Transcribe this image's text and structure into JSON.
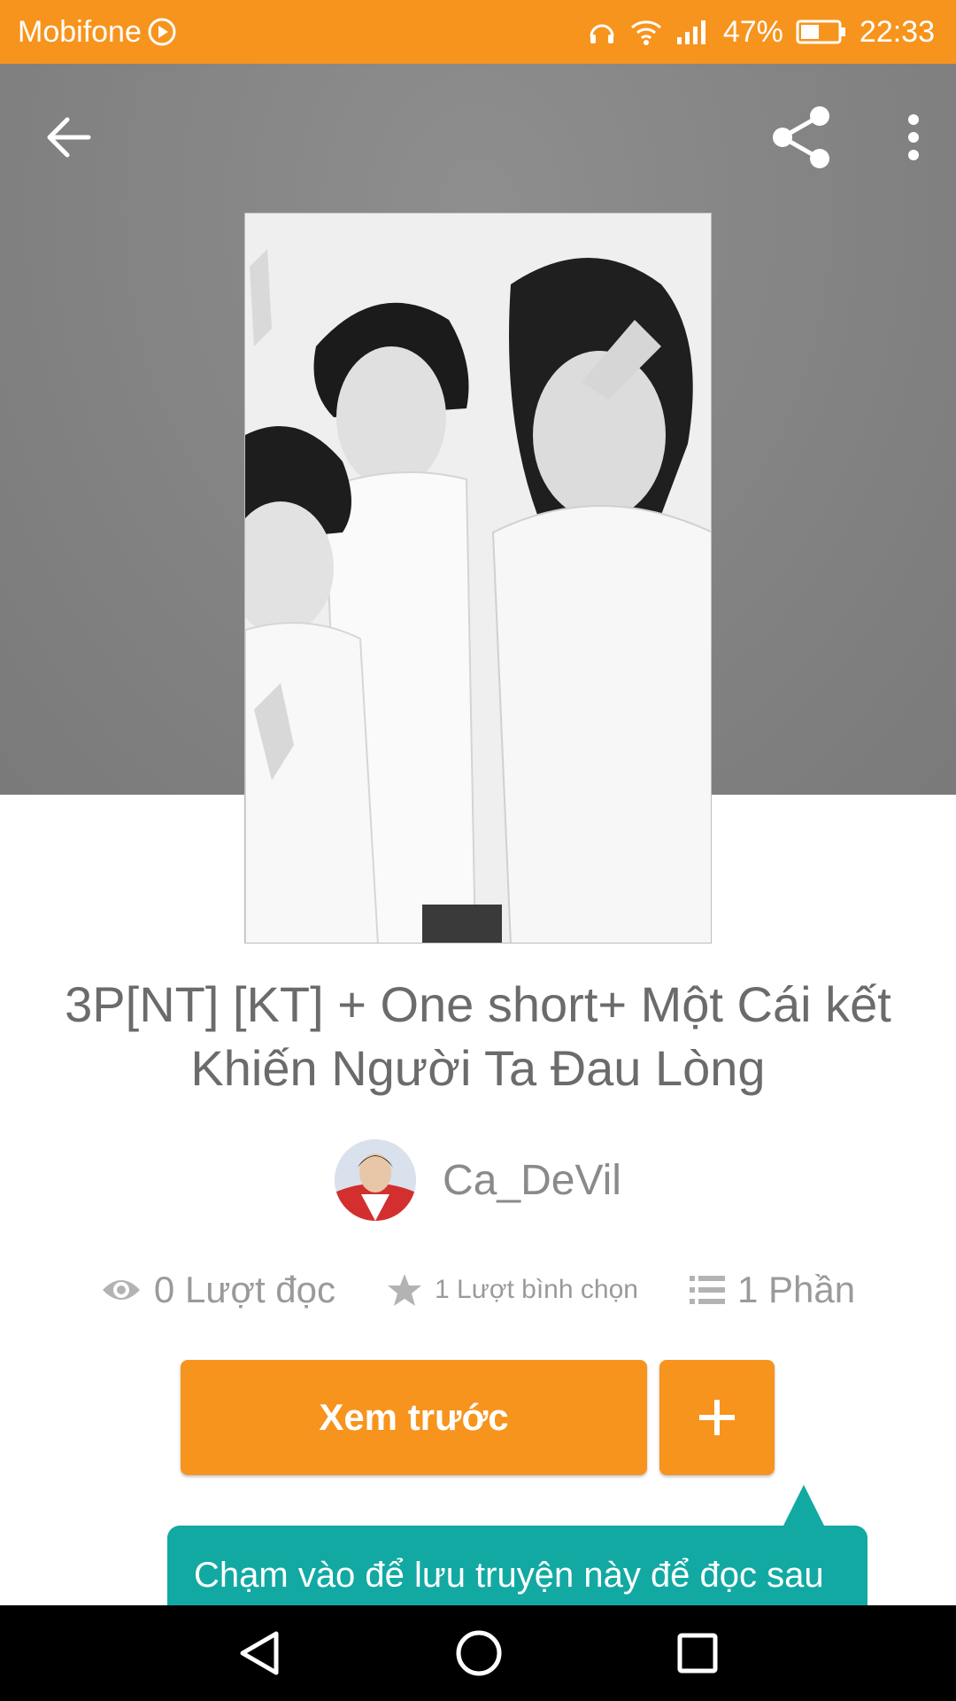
{
  "status_bar": {
    "carrier": "Mobifone",
    "battery": "47%",
    "time": "22:33"
  },
  "toolbar": {
    "back_icon": "arrow-left-icon",
    "share_icon": "share-icon",
    "more_icon": "more-vertical-icon"
  },
  "story": {
    "title": "3P[NT] [KT] + One short+ Một Cái kết Khiến Người Ta Đau Lòng",
    "author": "Ca_DeVil",
    "stats": {
      "reads": "0 Lượt đọc",
      "votes": "1 Lượt bình chọn",
      "parts": "1 Phần"
    }
  },
  "actions": {
    "preview_label": "Xem trước",
    "add_label": "+"
  },
  "tooltip": {
    "text": "Chạm vào để lưu truyện này để đọc sau"
  },
  "colors": {
    "accent": "#f7941d",
    "tooltip": "#12a9a3",
    "text_muted": "#9a9a9a"
  }
}
